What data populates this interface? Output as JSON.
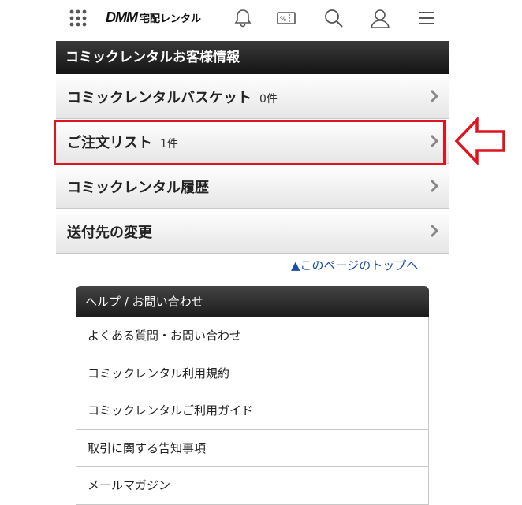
{
  "header": {
    "logo_mark": "DMM",
    "logo_text": "宅配レンタル",
    "icons": [
      "grid-icon",
      "bell-icon",
      "coupon-icon",
      "search-icon",
      "user-icon",
      "menu-icon"
    ],
    "coupon_glyph": "%"
  },
  "panel": {
    "title": "コミックレンタルお客様情報",
    "items": [
      {
        "label": "コミックレンタルバスケット",
        "count": "0件"
      },
      {
        "label": "ご注文リスト",
        "count": "1件"
      },
      {
        "label": "コミックレンタル履歴",
        "count": ""
      },
      {
        "label": "送付先の変更",
        "count": ""
      }
    ]
  },
  "top_link": "▲このページのトップへ",
  "help": {
    "title": "ヘルプ / お問い合わせ",
    "items": [
      "よくある質問・お問い合わせ",
      "コミックレンタル利用規約",
      "コミックレンタルご利用ガイド",
      "取引に関する告知事項",
      "メールマガジン"
    ]
  },
  "colors": {
    "highlight": "#e0141e",
    "link": "#1a4fa0"
  }
}
